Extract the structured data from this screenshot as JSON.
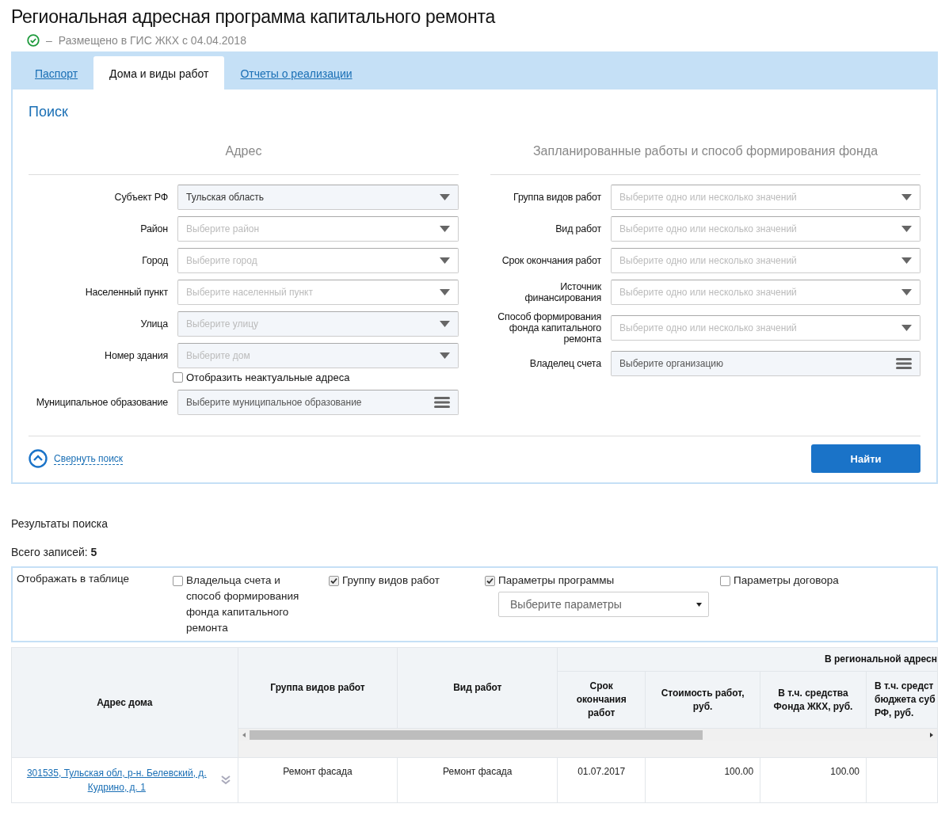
{
  "page": {
    "title": "Региональная адресная программа капитального ремонта",
    "status": {
      "dash": "–",
      "text": "Размещено в ГИС ЖКХ с 04.04.2018"
    }
  },
  "tabs": [
    {
      "label": "Паспорт",
      "selected": false
    },
    {
      "label": "Дома и виды работ",
      "selected": true
    },
    {
      "label": "Отчеты о реализации",
      "selected": false
    }
  ],
  "search": {
    "title": "Поиск",
    "columns": [
      {
        "heading": "Адрес",
        "rows": [
          {
            "kind": "select",
            "label": "Субъект РФ",
            "value": "Тульская область",
            "disabled": true
          },
          {
            "kind": "select",
            "label": "Район",
            "placeholder": "Выберите район",
            "disabled": false
          },
          {
            "kind": "select",
            "label": "Город",
            "placeholder": "Выберите город",
            "disabled": false
          },
          {
            "kind": "select",
            "label": "Населенный пункт",
            "placeholder": "Выберите населенный пункт",
            "disabled": false
          },
          {
            "kind": "select",
            "label": "Улица",
            "placeholder": "Выберите улицу",
            "disabled": true
          },
          {
            "kind": "select",
            "label": "Номер здания",
            "placeholder": "Выберите дом",
            "disabled": true
          },
          {
            "kind": "checkbox",
            "label": "Отобразить неактуальные адреса",
            "checked": false
          },
          {
            "kind": "lookup",
            "label": "Муниципальное образование",
            "placeholder": "Выберите муниципальное образование"
          }
        ]
      },
      {
        "heading": "Запланированные работы и способ формирования фонда",
        "rows": [
          {
            "kind": "select",
            "label": "Группа видов работ",
            "placeholder": "Выберите одно или несколько значений",
            "disabled": false
          },
          {
            "kind": "select",
            "label": "Вид работ",
            "placeholder": "Выберите одно или несколько значений",
            "disabled": false
          },
          {
            "kind": "select",
            "label": "Срок окончания работ",
            "placeholder": "Выберите одно или несколько значений",
            "disabled": false
          },
          {
            "kind": "select",
            "label": "Источник финансирования",
            "placeholder": "Выберите одно или несколько значений",
            "disabled": false
          },
          {
            "kind": "select",
            "label": "Способ формирования фонда капитального ремонта",
            "placeholder": "Выберите одно или несколько значений",
            "disabled": false
          },
          {
            "kind": "lookup",
            "label": "Владелец счета",
            "placeholder": "Выберите организацию"
          }
        ]
      }
    ],
    "collapse_link": "Свернуть поиск",
    "find_button": "Найти"
  },
  "results": {
    "title": "Результаты поиска",
    "total": "Всего записей: **5**",
    "display": {
      "label": "Отображать в таблице",
      "options": [
        {
          "label": "Владельца счета и способ формирования фонда капитального ремонта",
          "checked": false
        },
        {
          "label": "Группу видов работ",
          "checked": true
        },
        {
          "label": "Параметры программы",
          "checked": true,
          "select_value": "Выберите параметры"
        },
        {
          "label": "Параметры договора",
          "checked": false
        }
      ]
    }
  },
  "table": {
    "columns": [
      "Адрес дома",
      "Группа видов работ",
      "Вид работ"
    ],
    "group": {
      "label": "В региональной адресн",
      "columns": [
        "Срок окончания работ",
        "Стоимость работ, руб.",
        "В т.ч. средства Фонда ЖКХ, руб.",
        "В т.ч. средст\nбюджета суб\nРФ, руб."
      ]
    },
    "rows": [
      {
        "cells": [
          "301535, Тульская обл, р-н. Белевский, д. Кудрино, д. 1",
          "Ремонт фасада",
          "Ремонт фасада",
          "01.07.2017",
          "100.00",
          "100.00"
        ]
      }
    ]
  }
}
